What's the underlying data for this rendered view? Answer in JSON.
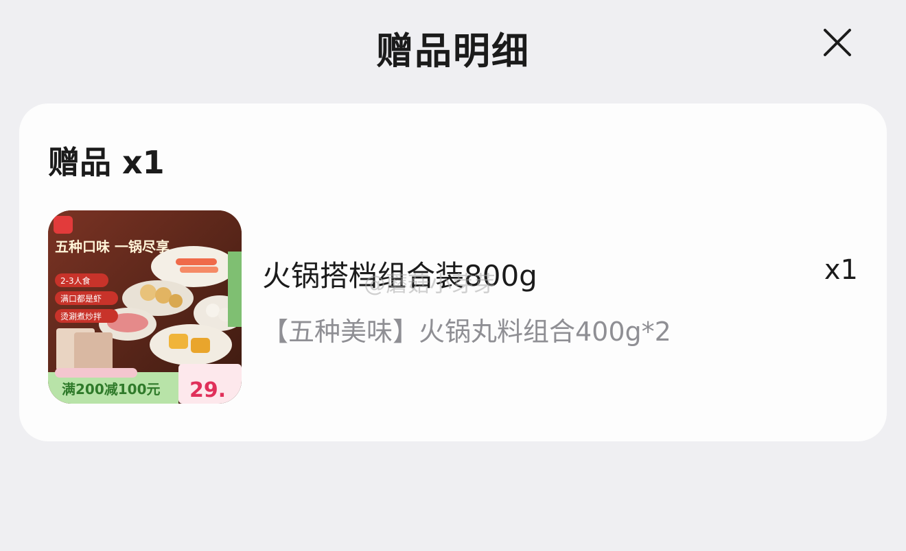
{
  "header": {
    "title": "赠品明细",
    "close_icon": "close-icon"
  },
  "gift_section": {
    "title": "赠品",
    "count": "x1"
  },
  "gift_item": {
    "name": "火锅搭档组合装800g",
    "spec": "【五种美味】火锅丸料组合400g*2",
    "quantity": "x1",
    "image": {
      "headline": "五种口味 一锅尽享",
      "tags": [
        "2-3人食",
        "满口都是虾",
        "烫涮煮炒拌"
      ],
      "promo": "满200减100元",
      "price": "29."
    }
  },
  "watermark": "@蘑菇小芽芽",
  "colors": {
    "background": "#efeff2",
    "card": "#fdfdfd",
    "title": "#1b1b1b",
    "secondary_text": "#8f8f94"
  }
}
